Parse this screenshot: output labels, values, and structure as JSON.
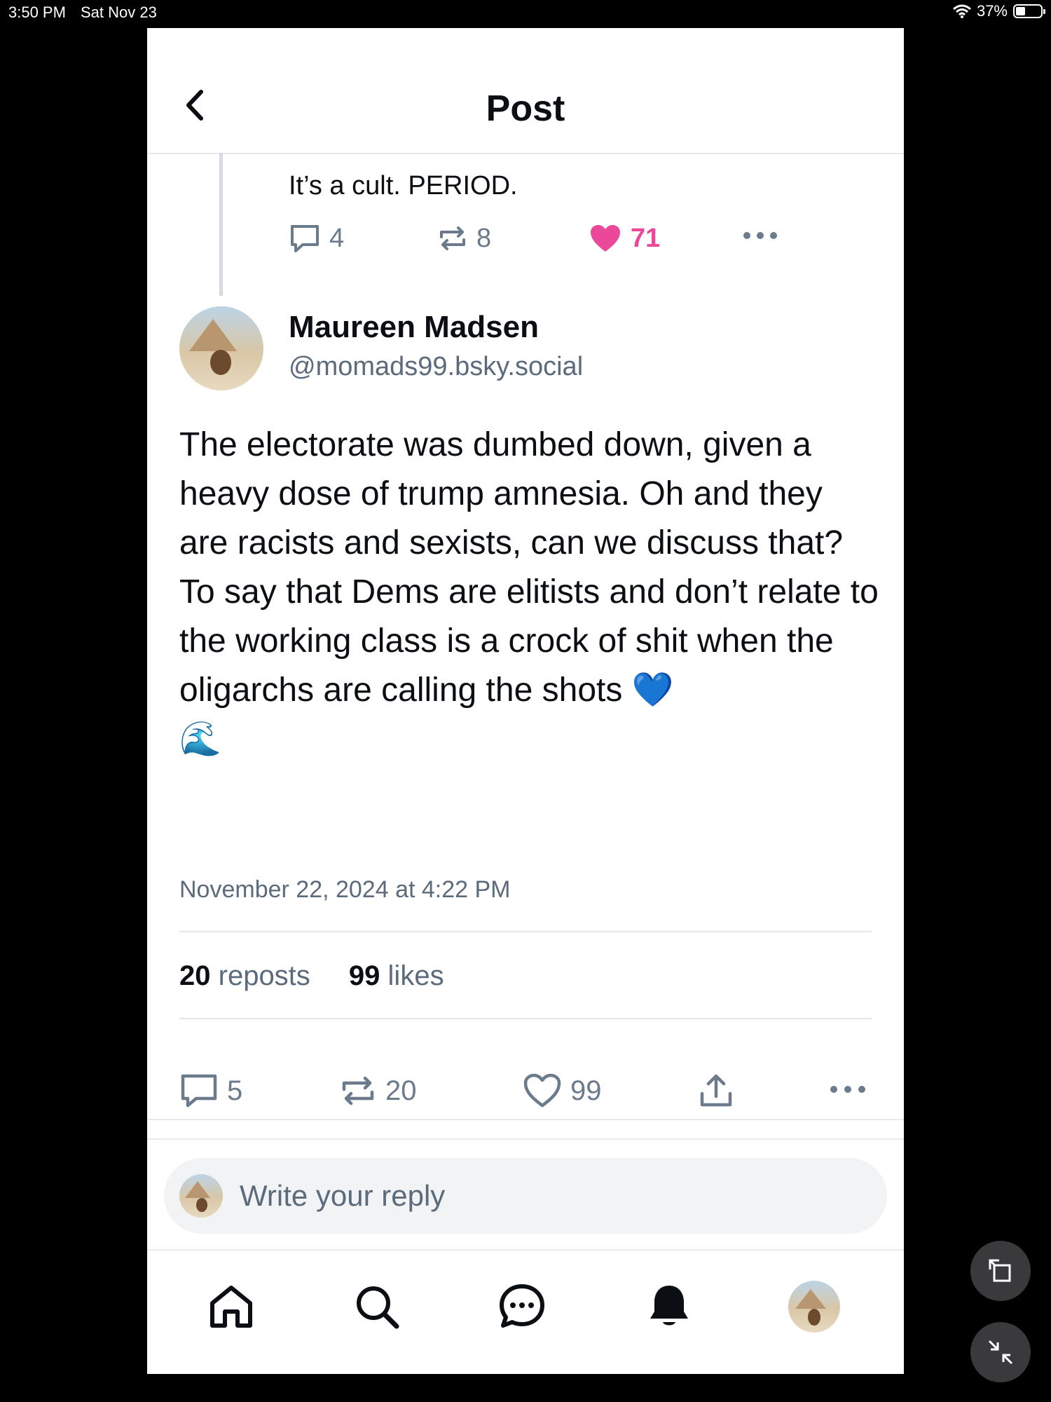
{
  "status_bar": {
    "time": "3:50 PM",
    "date": "Sat Nov 23",
    "battery": "37%",
    "battery_level": 0.37
  },
  "header": {
    "title": "Post",
    "back_icon": "chevron-left-icon"
  },
  "parent_post": {
    "text": "It’s a cult. PERIOD.",
    "replies": "4",
    "reposts": "8",
    "likes": "71",
    "liked": true,
    "like_color": "#ec4899"
  },
  "post": {
    "author_name": "Maureen Madsen",
    "author_handle": "@momads99.bsky.social",
    "body": "The electorate was dumbed down, given a heavy dose of trump amnesia. Oh and they are racists and sexists, can we discuss that?  To say that Dems are elitists and don’t relate to the working class is a crock of shit when the oligarchs are calling the shots 💙\n🌊",
    "timestamp": "November 22, 2024 at 4:22 PM",
    "stats": {
      "reposts_count": "20",
      "reposts_label": "reposts",
      "likes_count": "99",
      "likes_label": "likes"
    },
    "actions": {
      "replies": "5",
      "reposts": "20",
      "likes": "99"
    }
  },
  "reply_composer": {
    "placeholder": "Write your reply"
  },
  "bottom_nav": {
    "items": [
      "home-icon",
      "search-icon",
      "chat-icon",
      "bell-icon",
      "profile-avatar"
    ]
  },
  "colors": {
    "text": "#0b0f14",
    "secondary": "#5b6b7c",
    "icon": "#6b7b8c",
    "accent_like": "#ec4899"
  }
}
